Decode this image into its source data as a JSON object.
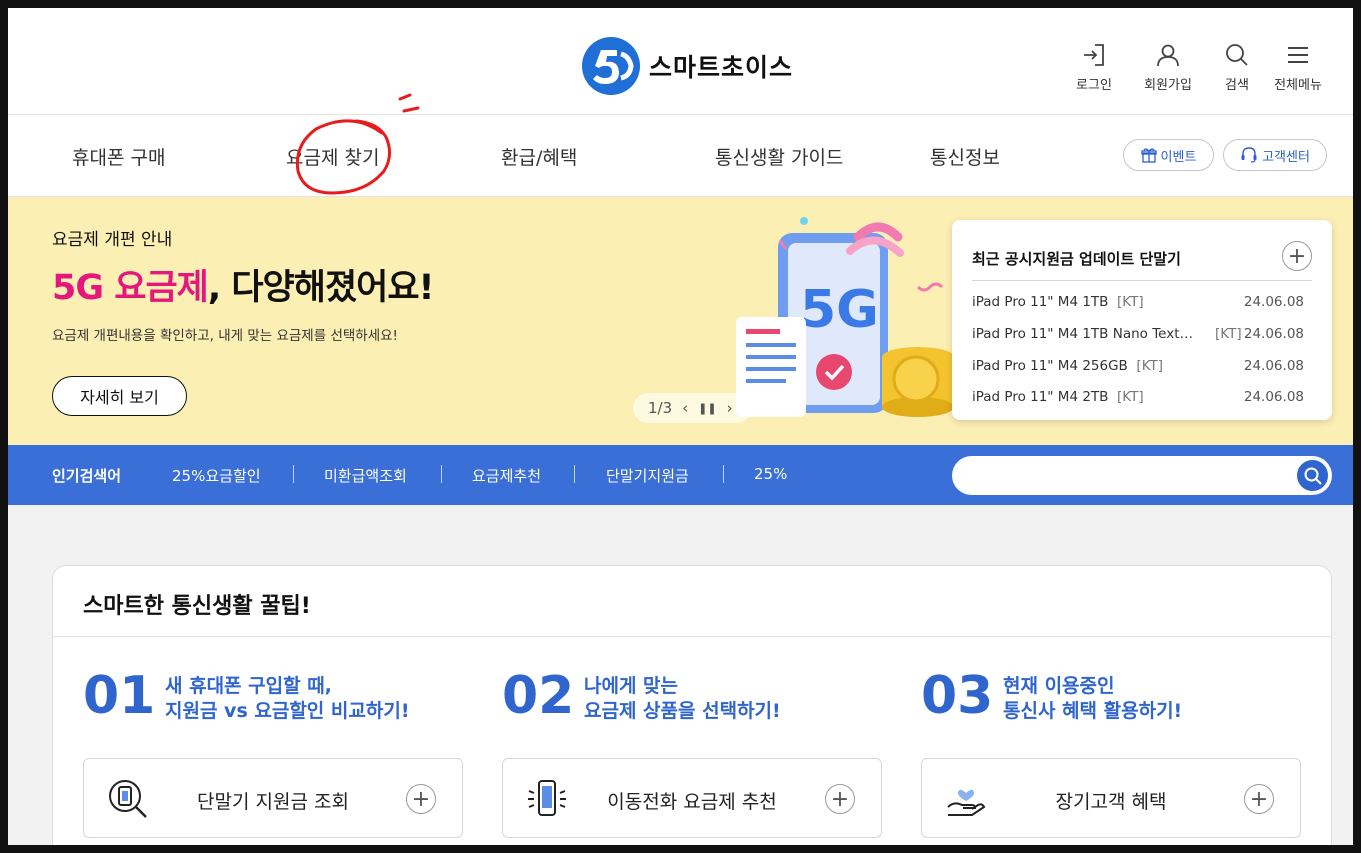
{
  "header": {
    "logo_text": "스마트초이스",
    "util": [
      {
        "label": "로그인",
        "icon": "login-icon"
      },
      {
        "label": "회원가입",
        "icon": "user-icon"
      },
      {
        "label": "검색",
        "icon": "search-icon"
      },
      {
        "label": "전체메뉴",
        "icon": "menu-icon"
      }
    ]
  },
  "nav": {
    "items": [
      "휴대폰 구매",
      "요금제 찾기",
      "환급/혜택",
      "통신생활 가이드",
      "통신정보"
    ],
    "event_label": "이벤트",
    "support_label": "고객센터",
    "annotation_color": "#e81c1c"
  },
  "banner": {
    "subtitle": "요금제 개편 안내",
    "title_highlight": "5G 요금제",
    "title_rest": ", 다양해졌어요!",
    "description": "요금제 개편내용을 확인하고, 내게 맞는 요금제를 선택하세요!",
    "button": "자세히 보기",
    "pager": "1/3",
    "art_label": "5G",
    "bg_color": "#fcefb4",
    "highlight_color": "#e5177c"
  },
  "updates": {
    "title": "최근 공시지원금 업데이트 단말기",
    "rows": [
      {
        "name": "iPad Pro 11\" M4 1TB",
        "carrier": "[KT]",
        "date": "24.06.08"
      },
      {
        "name": "iPad Pro 11\" M4 1TB Nano Textur…",
        "carrier": "[KT]",
        "date": "24.06.08"
      },
      {
        "name": "iPad Pro 11\" M4 256GB",
        "carrier": "[KT]",
        "date": "24.06.08"
      },
      {
        "name": "iPad Pro 11\" M4 2TB",
        "carrier": "[KT]",
        "date": "24.06.08"
      }
    ]
  },
  "popular": {
    "label": "인기검색어",
    "keywords": [
      "25%요금할인",
      "미환급액조회",
      "요금제추천",
      "단말기지원금",
      "25%"
    ],
    "search_value": "",
    "band_color": "#3a6fd8"
  },
  "tips": {
    "title": "스마트한 통신생활 꿀팁!",
    "columns": [
      {
        "num": "01",
        "line1": "새 휴대폰 구입할 때,",
        "line2": "지원금 vs 요금할인 비교하기!",
        "button": "단말기 지원금 조회",
        "icon": "phone-search-icon"
      },
      {
        "num": "02",
        "line1": "나에게 맞는",
        "line2": "요금제 상품을 선택하기!",
        "button": "이동전화 요금제 추천",
        "icon": "phone-sparkle-icon"
      },
      {
        "num": "03",
        "line1": "현재 이용중인",
        "line2": "통신사 혜택 활용하기!",
        "button": "장기고객 혜택",
        "icon": "heart-hand-icon"
      }
    ],
    "accent_color": "#2f65cc"
  }
}
